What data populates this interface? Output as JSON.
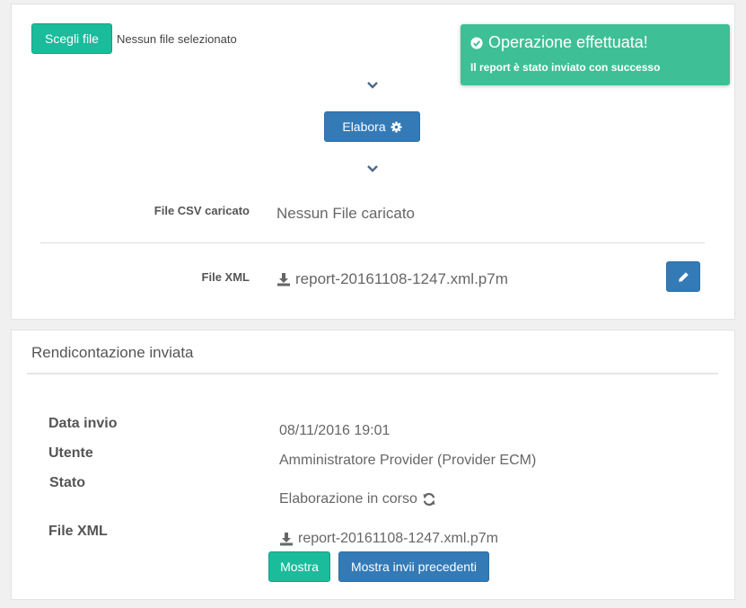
{
  "upload": {
    "choose_file_label": "Scegli file",
    "no_file_text": "Nessun file selezionato",
    "process_label": "Elabora",
    "csv_label": "File CSV caricato",
    "csv_value": "Nessun File caricato",
    "xml_label": "File XML",
    "xml_value": "report-20161108-1247.xml.p7m"
  },
  "toast": {
    "title": "Operazione effettuata!",
    "message": "Il report è stato inviato con successo",
    "color": "#3fbf95"
  },
  "report": {
    "title": "Rendicontazione inviata",
    "date_label": "Data invio",
    "date_value": "08/11/2016 19:01",
    "user_label": "Utente",
    "user_value": "Amministratore Provider (Provider ECM)",
    "state_label": "Stato",
    "state_value": "Elaborazione in corso",
    "xml_label": "File XML",
    "xml_value": "report-20161108-1247.xml.p7m",
    "show_label": "Mostra",
    "show_previous_label": "Mostra invii precedenti"
  },
  "icons": {
    "process": "gear-icon",
    "download": "download-icon",
    "edit": "pencil-icon",
    "success": "check-circle-icon",
    "state": "refresh-icon",
    "step": "chevron-down-icon"
  },
  "colors": {
    "teal": "#1abc9c",
    "blue": "#337ab7"
  }
}
